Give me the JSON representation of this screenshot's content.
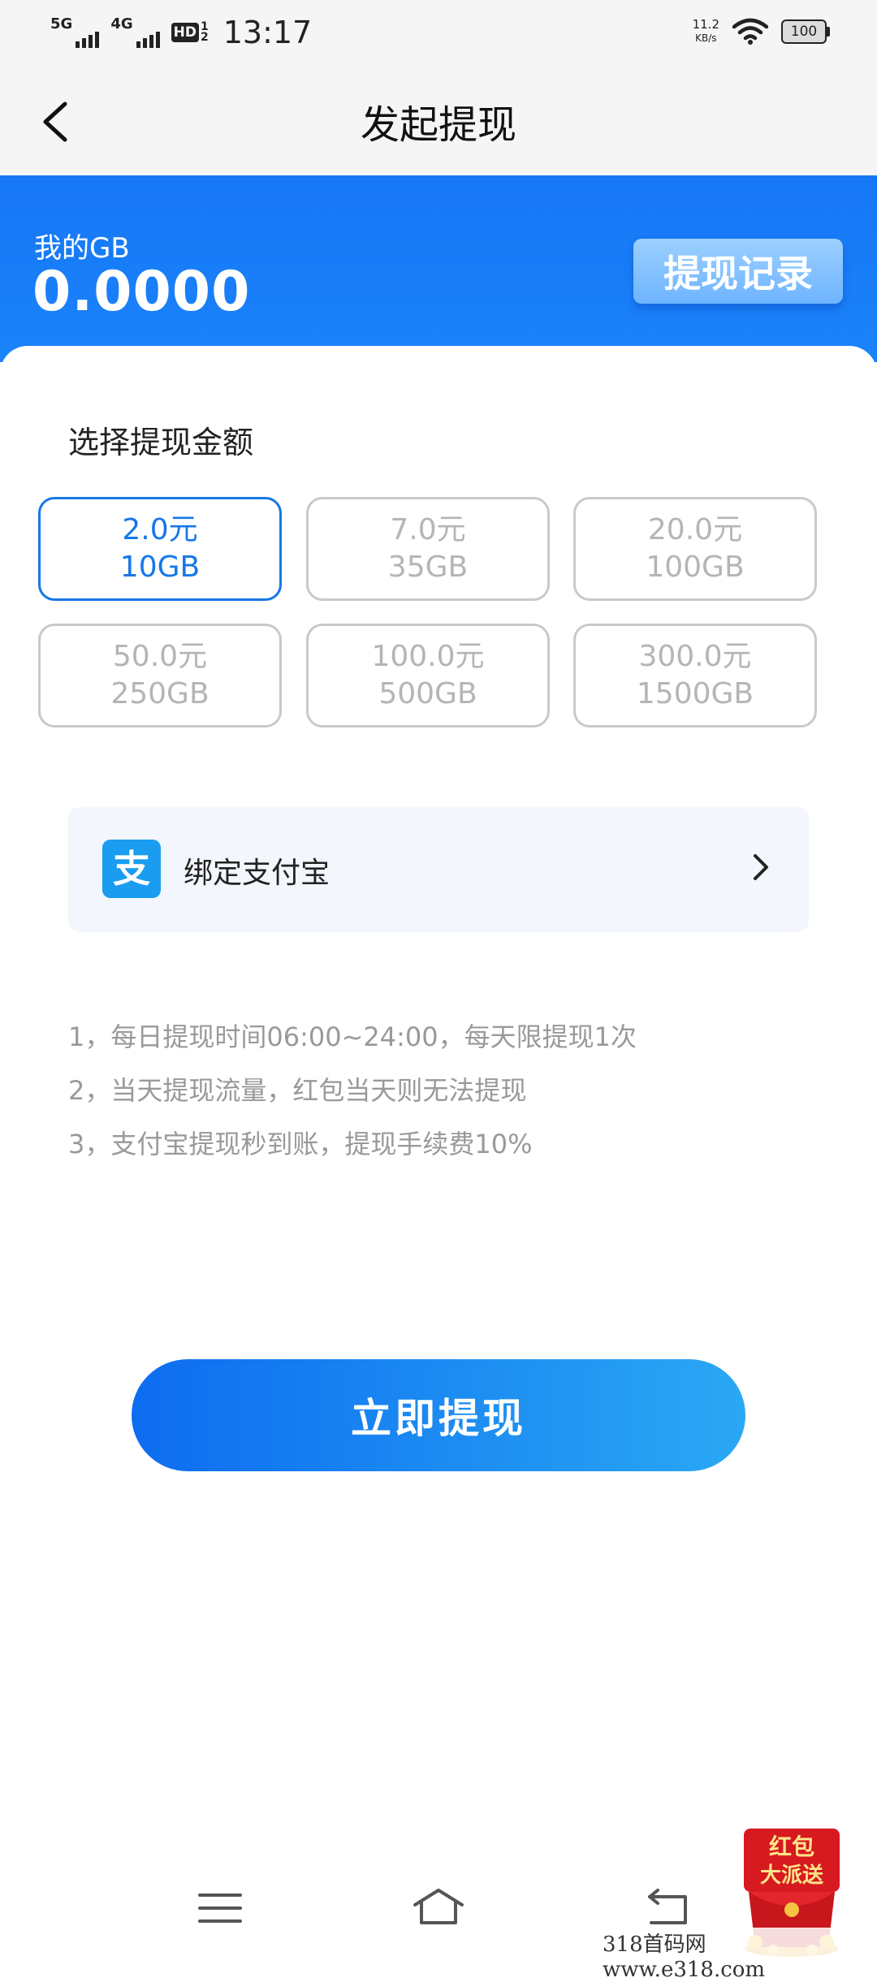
{
  "status_bar": {
    "network1": "5G",
    "network2": "4G",
    "hd_label": "HD",
    "hd_top": "1",
    "hd_bottom": "2",
    "time": "13:17",
    "speed_value": "11.2",
    "speed_unit": "KB/s",
    "battery": "100"
  },
  "header": {
    "title": "发起提现",
    "back_icon": "chevron-left-icon"
  },
  "balance": {
    "label": "我的GB",
    "value": "0.0000",
    "record_button": "提现记录"
  },
  "amount_section": {
    "title": "选择提现金额",
    "options": [
      {
        "price": "2.0元",
        "amount": "10GB",
        "selected": true
      },
      {
        "price": "7.0元",
        "amount": "35GB",
        "selected": false
      },
      {
        "price": "20.0元",
        "amount": "100GB",
        "selected": false
      },
      {
        "price": "50.0元",
        "amount": "250GB",
        "selected": false
      },
      {
        "price": "100.0元",
        "amount": "500GB",
        "selected": false
      },
      {
        "price": "300.0元",
        "amount": "1500GB",
        "selected": false
      }
    ]
  },
  "alipay": {
    "label": "绑定支付宝",
    "icon": "alipay-icon",
    "icon_glyph": "支"
  },
  "notes": [
    "1，每日提现时间06:00~24:00，每天限提现1次",
    "2，当天提现流量，红包当天则无法提现",
    "3，支付宝提现秒到账，提现手续费10%"
  ],
  "withdraw_button": "立即提现",
  "red_packet": {
    "line1": "红包",
    "line2": "大派送"
  },
  "watermark": "318首码网  www.e318.com",
  "colors": {
    "primary": "#1677e8",
    "banner": "#1a7ff8",
    "button_gradient_start": "#0d6cf0",
    "button_gradient_end": "#2aa8f4",
    "disabled_text": "#b5b5b5"
  }
}
